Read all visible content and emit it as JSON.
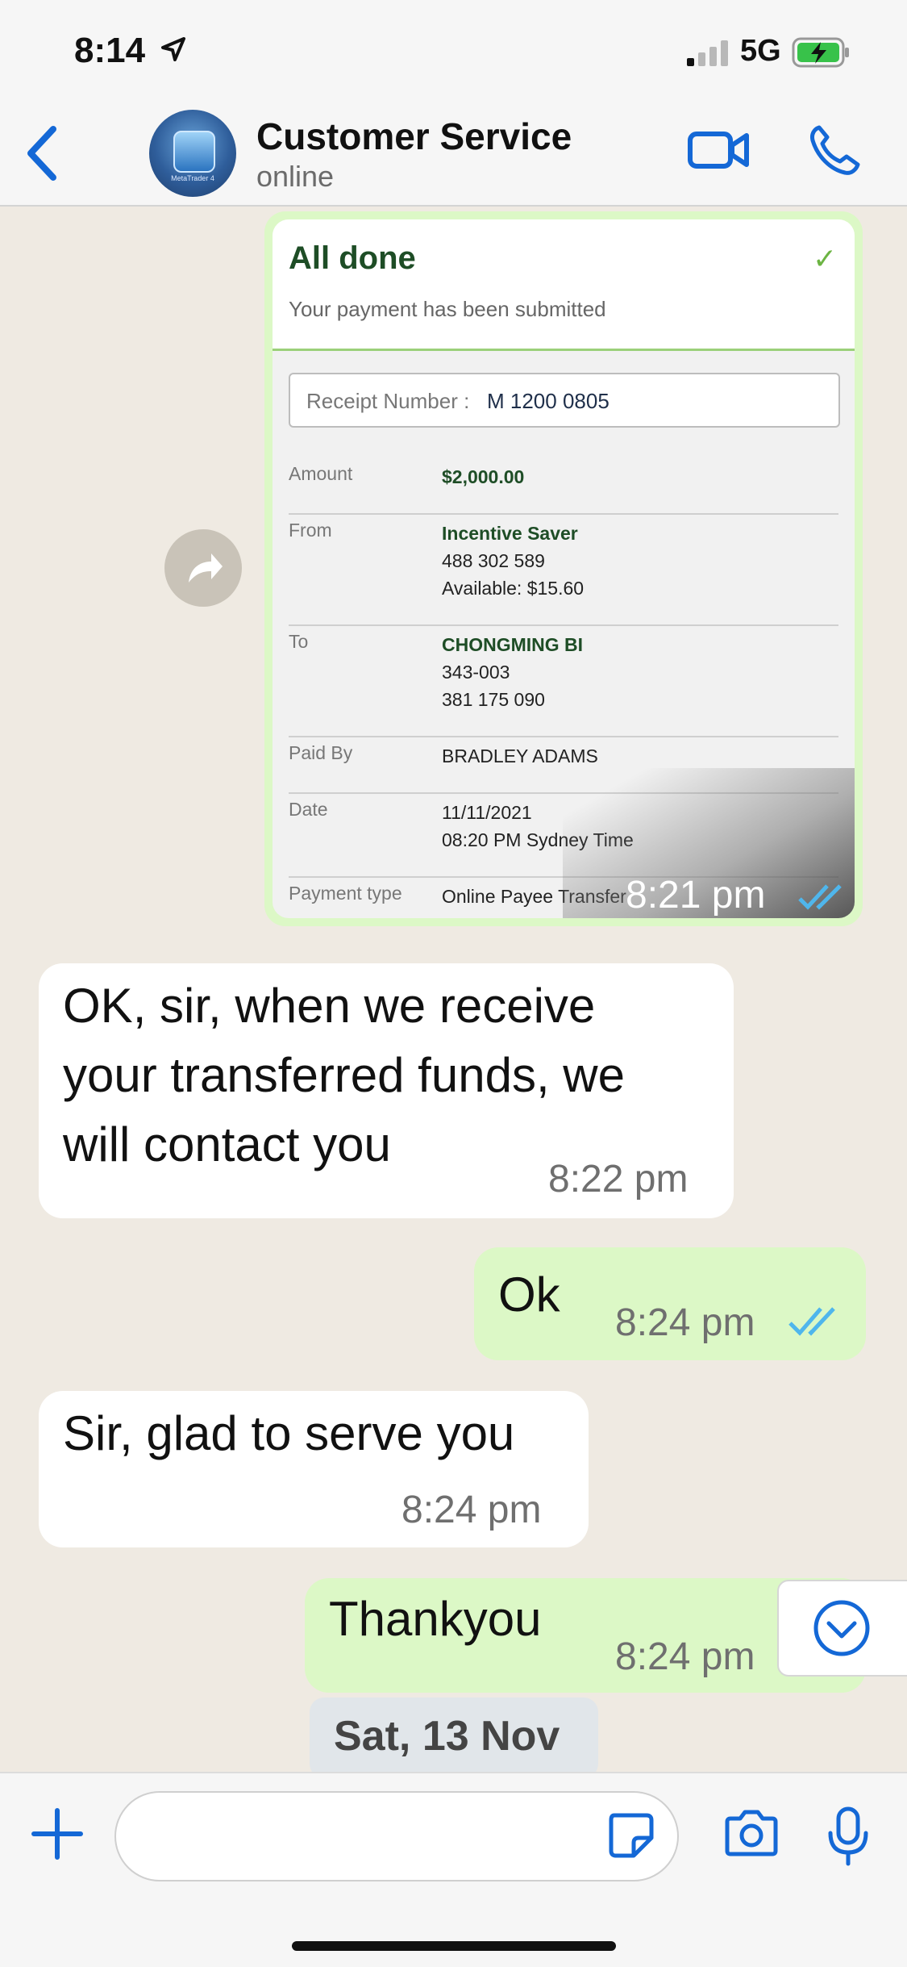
{
  "status_bar": {
    "time": "8:14",
    "network": "5G"
  },
  "header": {
    "title": "Customer Service",
    "subtitle": "online",
    "avatar_label": "MetaTrader 4"
  },
  "receipt": {
    "heading": "All done",
    "subheading": "Your payment has been submitted",
    "receipt_label": "Receipt Number :",
    "receipt_value": "M 1200 0805",
    "rows": [
      {
        "label": "Amount",
        "lines": [
          "$2,000.00"
        ]
      },
      {
        "label": "From",
        "lines": [
          "Incentive Saver",
          "488 302 589",
          "Available: $15.60"
        ]
      },
      {
        "label": "To",
        "lines": [
          "CHONGMING BI",
          "343-003",
          "381 175 090"
        ]
      },
      {
        "label": "Paid By",
        "lines": [
          "BRADLEY ADAMS"
        ]
      },
      {
        "label": "Date",
        "lines": [
          "11/11/2021",
          "08:20 PM Sydney Time"
        ]
      },
      {
        "label": "Payment type",
        "lines": [
          "Online Payee Transfer"
        ]
      }
    ],
    "time": "8:21 pm"
  },
  "messages": [
    {
      "direction": "in",
      "lines": [
        "OK, sir, when we receive",
        "your transferred funds, we",
        "will contact you"
      ],
      "time": "8:22 pm"
    },
    {
      "direction": "out",
      "lines": [
        "Ok"
      ],
      "time": "8:24 pm"
    },
    {
      "direction": "in",
      "lines": [
        "Sir, glad to serve you"
      ],
      "time": "8:24 pm"
    },
    {
      "direction": "out",
      "lines": [
        "Thankyou"
      ],
      "time": "8:24 pm"
    }
  ],
  "date_separator": "Sat, 13 Nov",
  "colors": {
    "accent": "#1468d6",
    "read_tick": "#4fb6ec",
    "outgoing_bubble": "#dcf8c6",
    "incoming_bubble": "#ffffff",
    "chat_bg": "#efeae2"
  }
}
